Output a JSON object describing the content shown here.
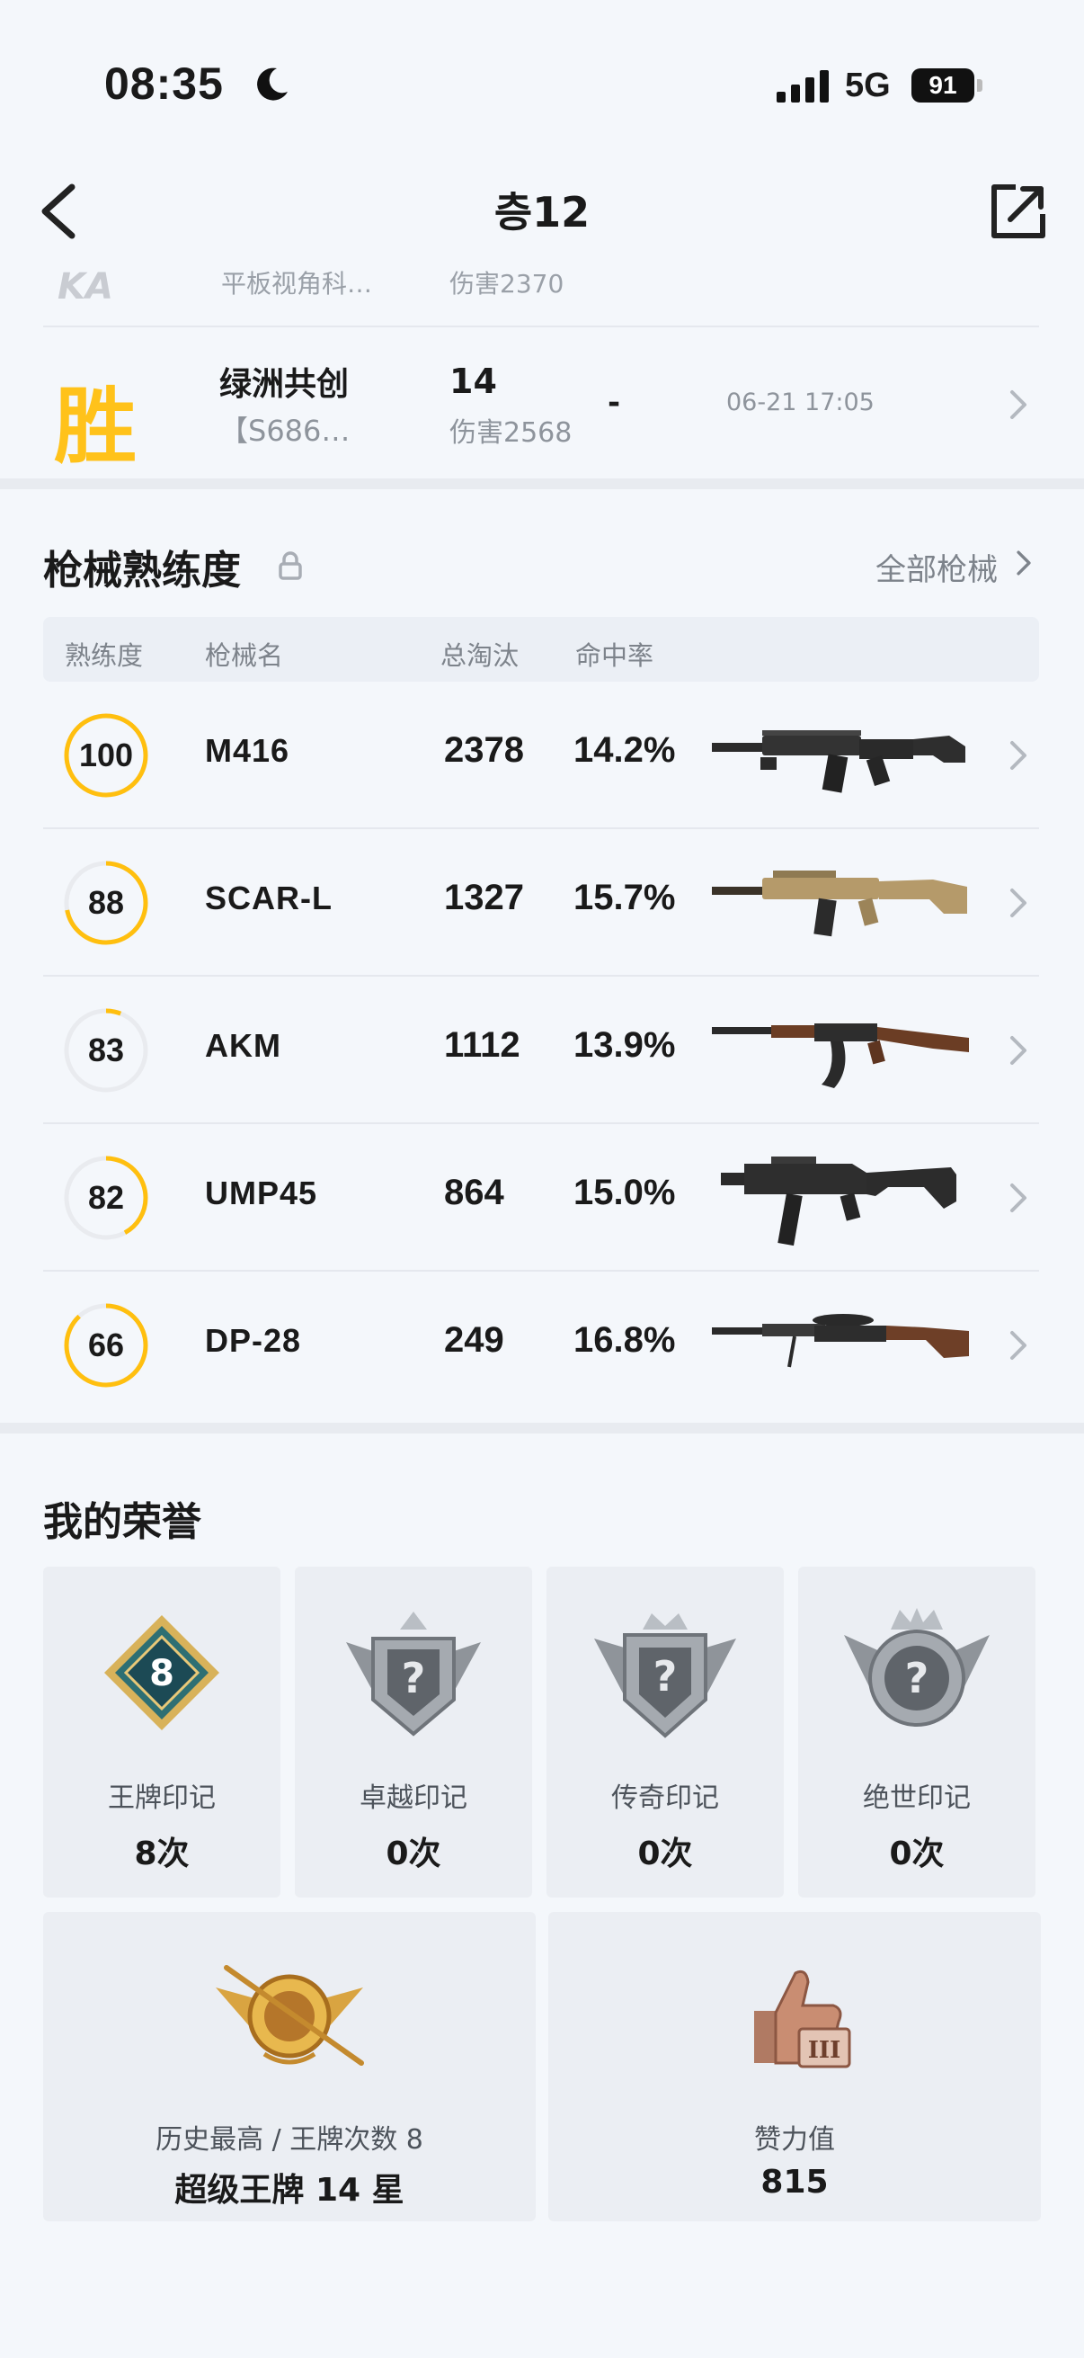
{
  "status_bar": {
    "time": "08:35",
    "network": "5G",
    "battery": "91"
  },
  "nav": {
    "title": "층12"
  },
  "matches": {
    "partial": {
      "logo_text": "KA",
      "mode": "平板视角科…",
      "damage": "伤害2370"
    },
    "latest": {
      "result": "胜",
      "mode": "绿洲共创",
      "sub": "【S686…",
      "kills": "14",
      "damage": "伤害2568",
      "dash": "-",
      "time": "06-21 17:05"
    }
  },
  "weapons": {
    "title": "枪械熟练度",
    "all_link": "全部枪械",
    "headers": {
      "mastery": "熟练度",
      "name": "枪械名",
      "kills": "总淘汰",
      "accuracy": "命中率"
    },
    "accent": "#ffbf0f",
    "rows": [
      {
        "mastery": "100",
        "progress": 1.0,
        "name": "M416",
        "kills": "2378",
        "accuracy": "14.2%",
        "icon": "m416-rifle-icon"
      },
      {
        "mastery": "88",
        "progress": 0.72,
        "name": "SCAR-L",
        "kills": "1327",
        "accuracy": "15.7%",
        "icon": "scar-l-rifle-icon"
      },
      {
        "mastery": "83",
        "progress": 0.06,
        "name": "AKM",
        "kills": "1112",
        "accuracy": "13.9%",
        "icon": "akm-rifle-icon"
      },
      {
        "mastery": "82",
        "progress": 0.42,
        "name": "UMP45",
        "kills": "864",
        "accuracy": "15.0%",
        "icon": "ump45-smg-icon"
      },
      {
        "mastery": "66",
        "progress": 0.88,
        "name": "DP-28",
        "kills": "249",
        "accuracy": "16.8%",
        "icon": "dp28-lmg-icon"
      }
    ]
  },
  "honors": {
    "title": "我的荣誉",
    "marks": [
      {
        "label": "王牌印记",
        "value": "8次",
        "badge_number": "8",
        "icon": "ace-mark-badge-icon"
      },
      {
        "label": "卓越印记",
        "value": "0次",
        "badge_number": "?",
        "icon": "excellence-mark-badge-icon"
      },
      {
        "label": "传奇印记",
        "value": "0次",
        "badge_number": "?",
        "icon": "legend-mark-badge-icon"
      },
      {
        "label": "绝世印记",
        "value": "0次",
        "badge_number": "?",
        "icon": "peerless-mark-badge-icon"
      }
    ],
    "highest": {
      "label": "历史最高 / 王牌次数 8",
      "value": "超级王牌 14 星",
      "icon": "super-ace-badge-icon"
    },
    "likes": {
      "label": "赞力值",
      "value": "815",
      "badge_number": "III",
      "icon": "thumbs-up-badge-icon"
    }
  }
}
